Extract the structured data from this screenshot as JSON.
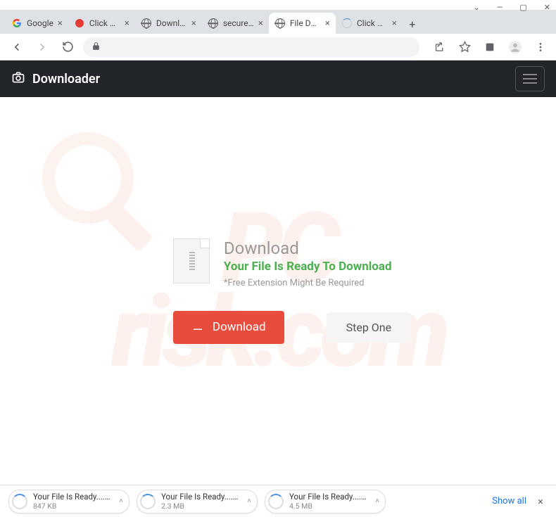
{
  "window": {
    "minimize": "—",
    "maximize": "▢",
    "close": "✕",
    "dropdown": "⌄"
  },
  "tabs": [
    {
      "title": "Google",
      "favicon": "google"
    },
    {
      "title": "Click Allow",
      "favicon": "red"
    },
    {
      "title": "Download...",
      "favicon": "globe"
    },
    {
      "title": "secureddo...",
      "favicon": "globe"
    },
    {
      "title": "File Downl...",
      "favicon": "globe",
      "active": true
    },
    {
      "title": "Click Allow",
      "favicon": "spin"
    }
  ],
  "header": {
    "brand": "Downloader"
  },
  "main": {
    "heading": "Download",
    "ready": "Your File Is Ready To Download",
    "note": "*Free Extension Might Be Required",
    "download_btn": "Download",
    "step_btn": "Step One"
  },
  "downloads": {
    "items": [
      {
        "name": "Your File Is Ready....vhd",
        "size": "847 KB"
      },
      {
        "name": "Your File Is Ready....vhd",
        "size": "2.3 MB"
      },
      {
        "name": "Your File Is Ready....vhd",
        "size": "4.5 MB"
      }
    ],
    "show_all": "Show all"
  },
  "watermark": {
    "top": "PC",
    "bottom": "risk.com"
  }
}
